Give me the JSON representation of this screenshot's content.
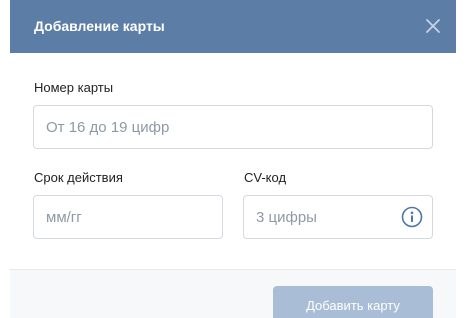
{
  "dialog": {
    "title": "Добавление карты",
    "close_icon": "close-icon"
  },
  "card_number": {
    "label": "Номер карты",
    "placeholder": "От 16 до 19 цифр",
    "value": ""
  },
  "expiry": {
    "label": "Срок действия",
    "placeholder": "мм/гг",
    "value": ""
  },
  "cvv": {
    "label": "CV-код",
    "placeholder": "3 цифры",
    "value": "",
    "info_icon": "info-icon"
  },
  "footer": {
    "submit_label": "Добавить карту"
  },
  "colors": {
    "header": "#5b7da6",
    "submit_disabled": "#aabdd6",
    "info_accent": "#4a76a8",
    "placeholder": "#8f99a5"
  }
}
